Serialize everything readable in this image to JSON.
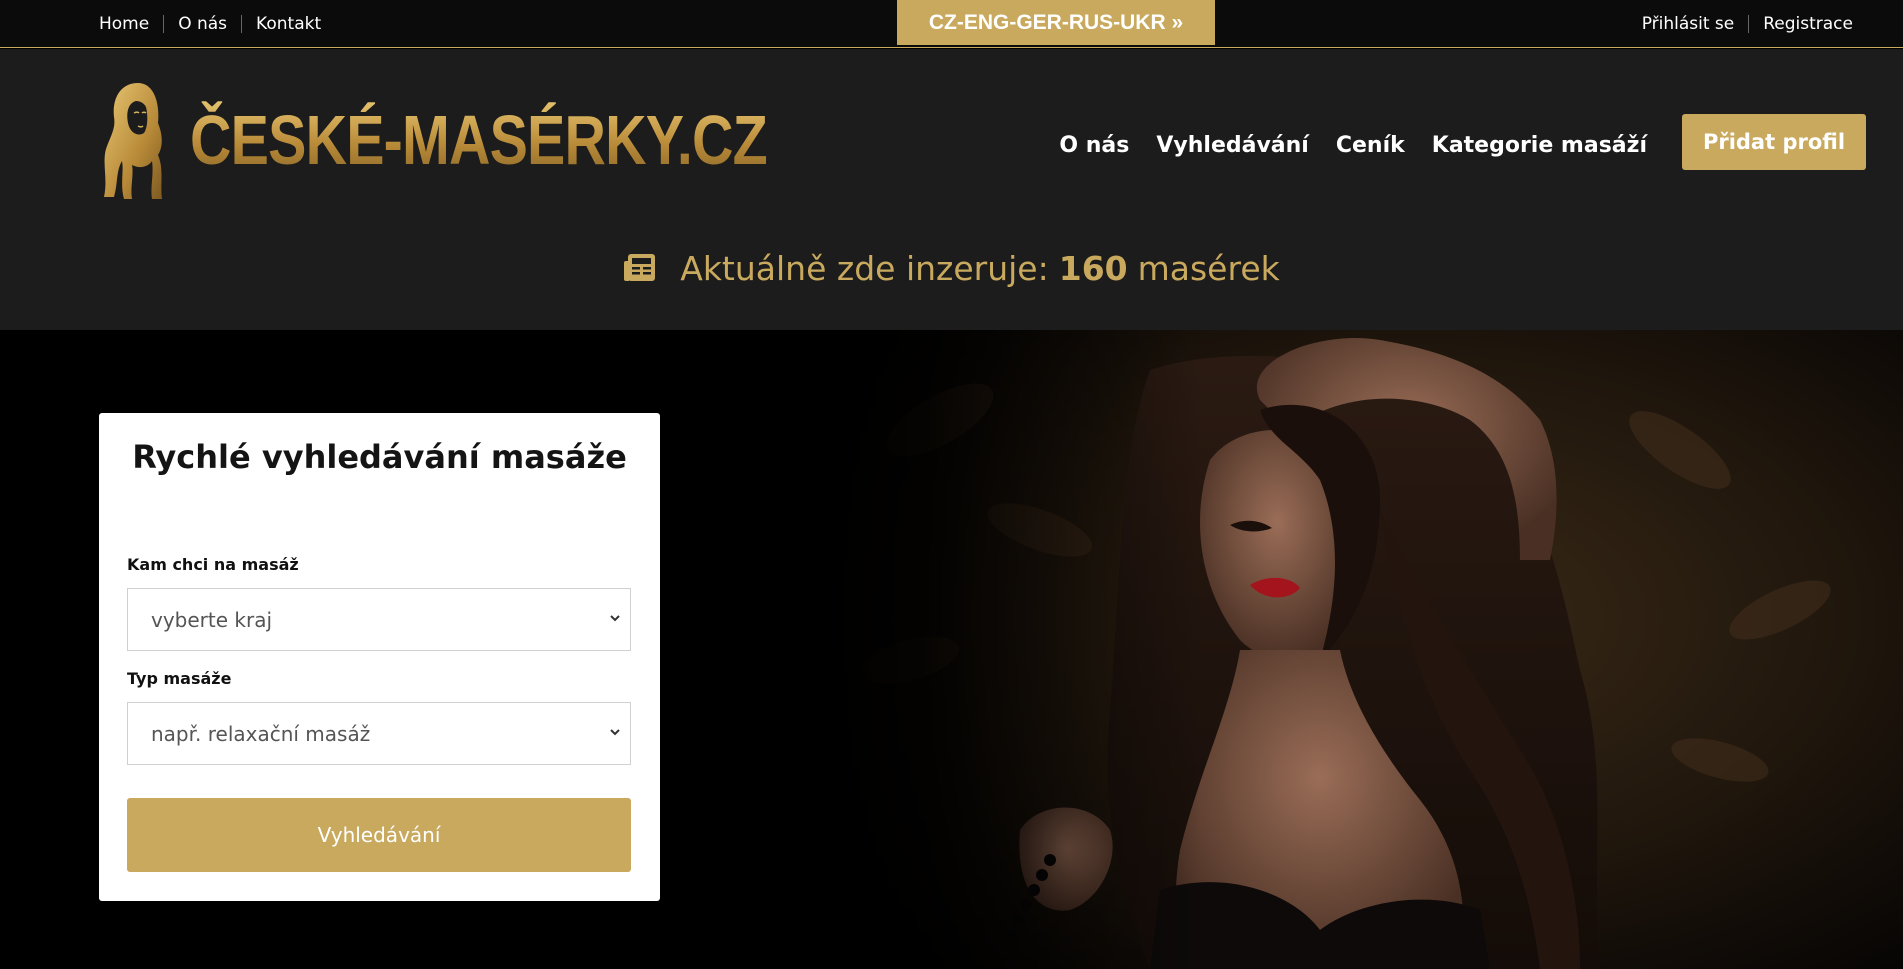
{
  "topbar": {
    "links": [
      "Home",
      "O nás",
      "Kontakt"
    ],
    "language_button": "CZ-ENG-GER-RUS-UKR »",
    "auth_links": [
      "Přihlásit se",
      "Registrace"
    ]
  },
  "header": {
    "logo_text": "ČESKÉ-MASÉRKY.CZ",
    "nav": [
      "O nás",
      "Vyhledávání",
      "Ceník",
      "Kategorie masáží"
    ],
    "add_profile_label": "Přidat profil",
    "counter": {
      "prefix": "Aktuálně zde inzeruje:",
      "count": "160",
      "suffix": "masérek"
    }
  },
  "search": {
    "title": "Rychlé vyhledávání masáže",
    "region_label": "Kam chci na masáž",
    "region_selected": "vyberte kraj",
    "type_label": "Typ masáže",
    "type_selected": "např. relaxační masáž",
    "submit_label": "Vyhledávání"
  },
  "colors": {
    "accent": "#c8a95e",
    "header_bg": "#1c1c1c",
    "topbar_bg": "#0b0b0b"
  }
}
